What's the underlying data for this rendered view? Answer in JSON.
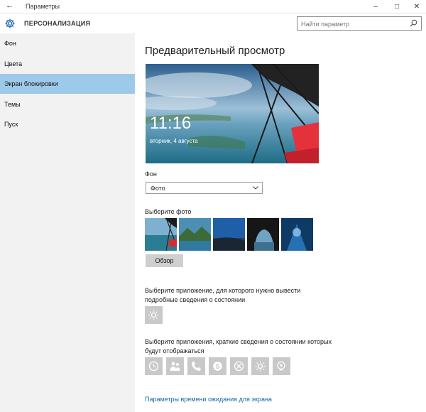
{
  "window": {
    "back_glyph": "←",
    "title": "Параметры",
    "minimize_glyph": "–",
    "maximize_glyph": "□",
    "close_glyph": "✕"
  },
  "header": {
    "section_title": "ПЕРСОНАЛИЗАЦИЯ",
    "gear_icon": "gear-icon",
    "search": {
      "placeholder": "Найти параметр",
      "icon": "search-icon"
    }
  },
  "sidebar": {
    "items": [
      {
        "label": "Фон",
        "active": false
      },
      {
        "label": "Цвета",
        "active": false
      },
      {
        "label": "Экран блокировки",
        "active": true
      },
      {
        "label": "Темы",
        "active": false
      },
      {
        "label": "Пуск",
        "active": false
      }
    ]
  },
  "main": {
    "heading": "Предварительный просмотр",
    "preview": {
      "time": "11:16",
      "date": "вторник, 4 августа"
    },
    "background": {
      "label": "Фон",
      "selected": "Фото"
    },
    "choose_photo": {
      "label": "Выберите фото",
      "browse_label": "Обзор"
    },
    "detailed_app": {
      "label": "Выберите приложение, для которого нужно вывести подробные сведения о состоянии",
      "icon": "weather-icon"
    },
    "quick_apps": {
      "label": "Выберите приложения, краткие сведения о состоянии которых будут отображаться",
      "icons": [
        "alarm-icon",
        "people-icon",
        "phone-icon",
        "skype-icon",
        "xbox-icon",
        "weather-icon",
        "store-icon"
      ]
    },
    "timeout_link": "Параметры времени ожидания для экрана"
  },
  "colors": {
    "active_nav": "#9ecae9",
    "sidebar_bg": "#f2f2f2",
    "link": "#1a66a8",
    "app_tile": "#c9c9c9"
  }
}
